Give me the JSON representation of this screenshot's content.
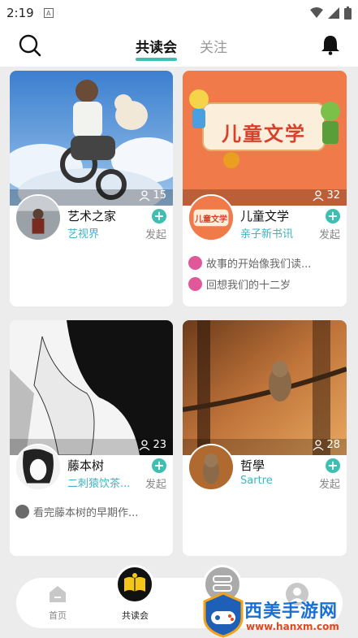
{
  "status_bar": {
    "time": "2:19",
    "notification_icon": "A"
  },
  "header": {
    "tabs": [
      {
        "label": "共读会",
        "active": true
      },
      {
        "label": "关注",
        "active": false
      }
    ]
  },
  "groups": [
    {
      "name": "艺术之家",
      "subtitle": "艺视界",
      "members": "15",
      "join_label": "发起",
      "posts": []
    },
    {
      "name": "儿童文学",
      "subtitle": "亲子新书讯",
      "members": "32",
      "join_label": "发起",
      "cover_title": "儿童文学",
      "posts": [
        "故事的开始像我们读...",
        "回想我们的十二岁"
      ]
    },
    {
      "name": "藤本树",
      "subtitle": "二刺猿饮茶...",
      "members": "23",
      "join_label": "发起",
      "posts": [
        "看完藤本树的早期作..."
      ]
    },
    {
      "name": "哲學",
      "subtitle": "Sartre",
      "members": "28",
      "join_label": "发起",
      "posts": []
    }
  ],
  "bottom_nav": {
    "items": [
      {
        "label": "首页"
      },
      {
        "label": "共读会"
      }
    ]
  },
  "watermark": {
    "title": "西美手游网",
    "url": "www.hanxm.com"
  },
  "colors": {
    "accent": "#3fbfb2",
    "link": "#3fb3c6"
  }
}
